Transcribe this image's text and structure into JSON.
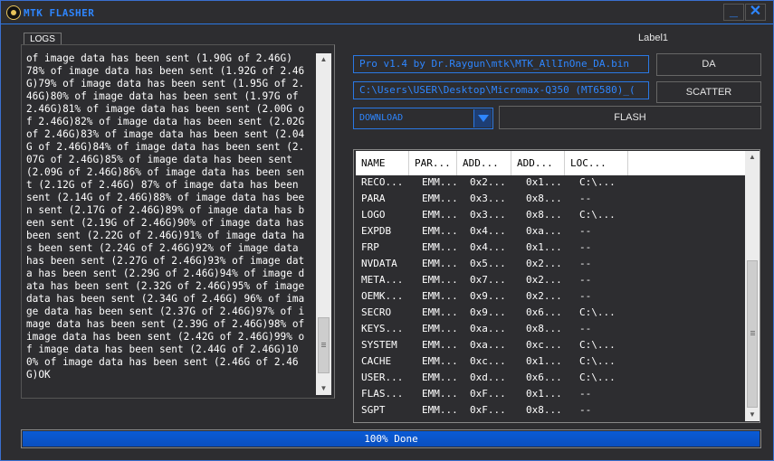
{
  "window": {
    "title": "MTK FLASHER",
    "minimize_label": "_",
    "close_label": "✕",
    "icon": "app-logo-icon",
    "accent_color": "#2e86ff"
  },
  "logs": {
    "tab_label": "LOGS",
    "text": "of image data has been sent (1.90G of 2.46G)\n78% of image data has been sent (1.92G of 2.46G)79% of image data has been sent (1.95G of 2.46G)80% of image data has been sent (1.97G of 2.46G)81% of image data has been sent (2.00G of 2.46G)82% of image data has been sent (2.02G of 2.46G)83% of image data has been sent (2.04G of 2.46G)84% of image data has been sent (2.07G of 2.46G)85% of image data has been sent (2.09G of 2.46G)86% of image data has been sent (2.12G of 2.46G) 87% of image data has been sent (2.14G of 2.46G)88% of image data has been sent (2.17G of 2.46G)89% of image data has been sent (2.19G of 2.46G)90% of image data has been sent (2.22G of 2.46G)91% of image data has been sent (2.24G of 2.46G)92% of image data has been sent (2.27G of 2.46G)93% of image data has been sent (2.29G of 2.46G)94% of image data has been sent (2.32G of 2.46G)95% of image data has been sent (2.34G of 2.46G) 96% of image data has been sent (2.37G of 2.46G)97% of image data has been sent (2.39G of 2.46G)98% of image data has been sent (2.42G of 2.46G)99% of image data has been sent (2.44G of 2.46G)100% of image data has been sent (2.46G of 2.46G)OK"
  },
  "label1": "Label1",
  "da_path": "Pro v1.4 by Dr.Raygun\\mtk\\MTK_AllInOne_DA.bin",
  "scatter_path": "C:\\Users\\USER\\Desktop\\Micromax-Q350 (MT6580)_(",
  "buttons": {
    "da": "DA",
    "scatter": "SCATTER",
    "flash": "FLASH"
  },
  "mode_select": {
    "selected": "DOWNLOAD"
  },
  "partition_table": {
    "columns": [
      "NAME",
      "PAR...",
      "ADD...",
      "ADD...",
      "LOC..."
    ],
    "rows": [
      [
        "RECO...",
        "EMM...",
        "0x2...",
        "0x1...",
        "C:\\..."
      ],
      [
        "PARA",
        "EMM...",
        "0x3...",
        "0x8...",
        "--"
      ],
      [
        "LOGO",
        "EMM...",
        "0x3...",
        "0x8...",
        "C:\\..."
      ],
      [
        "EXPDB",
        "EMM...",
        "0x4...",
        "0xa...",
        "--"
      ],
      [
        "FRP",
        "EMM...",
        "0x4...",
        "0x1...",
        "--"
      ],
      [
        "NVDATA",
        "EMM...",
        "0x5...",
        "0x2...",
        "--"
      ],
      [
        "META...",
        "EMM...",
        "0x7...",
        "0x2...",
        "--"
      ],
      [
        "OEMK...",
        "EMM...",
        "0x9...",
        "0x2...",
        "--"
      ],
      [
        "SECRO",
        "EMM...",
        "0x9...",
        "0x6...",
        "C:\\..."
      ],
      [
        "KEYS...",
        "EMM...",
        "0xa...",
        "0x8...",
        "--"
      ],
      [
        "SYSTEM",
        "EMM...",
        "0xa...",
        "0xc...",
        "C:\\..."
      ],
      [
        "CACHE",
        "EMM...",
        "0xc...",
        "0x1...",
        "C:\\..."
      ],
      [
        "USER...",
        "EMM...",
        "0xd...",
        "0x6...",
        "C:\\..."
      ],
      [
        "FLAS...",
        "EMM...",
        "0xF...",
        "0x1...",
        "--"
      ],
      [
        "SGPT",
        "EMM...",
        "0xF...",
        "0x8...",
        "--"
      ]
    ]
  },
  "progress": {
    "percent": 100,
    "label": "100% Done"
  }
}
